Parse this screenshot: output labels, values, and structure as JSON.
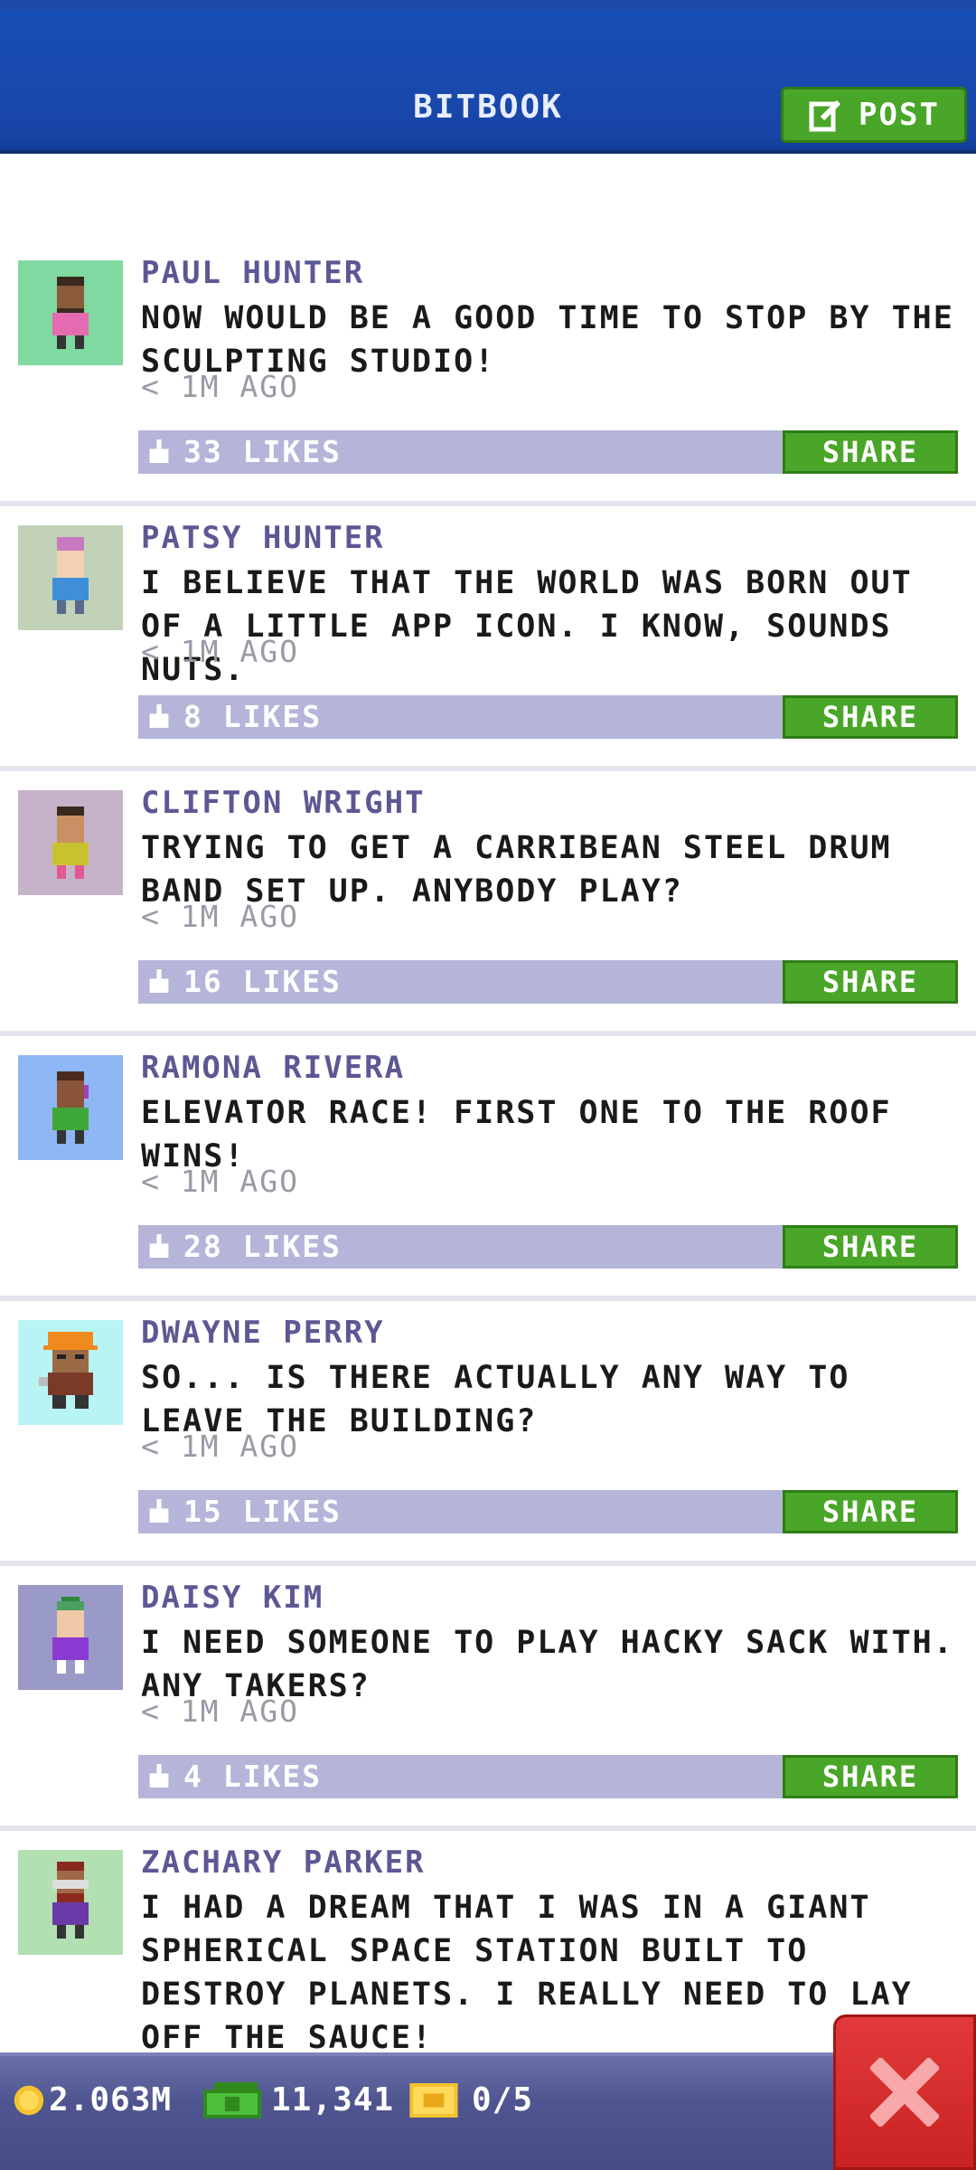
{
  "header": {
    "title": "BITBOOK",
    "post_label": "POST"
  },
  "posts": [
    {
      "author": "PAUL HUNTER",
      "message": "NOW WOULD BE A GOOD TIME TO STOP BY THE SCULPTING STUDIO!",
      "time": "< 1M AGO",
      "likes": "33 LIKES",
      "share": "SHARE",
      "avatar_bg": "#7fd9a0"
    },
    {
      "author": "PATSY HUNTER",
      "message": "I BELIEVE THAT THE WORLD WAS BORN OUT OF A LITTLE APP ICON. I KNOW, SOUNDS NUTS.",
      "time": "< 1M AGO",
      "likes": "8 LIKES",
      "share": "SHARE",
      "avatar_bg": "#c2d2b8"
    },
    {
      "author": "CLIFTON WRIGHT",
      "message": "TRYING TO GET A CARRIBEAN STEEL DRUM BAND SET UP. ANYBODY PLAY?",
      "time": "< 1M AGO",
      "likes": "16 LIKES",
      "share": "SHARE",
      "avatar_bg": "#c6b3c9"
    },
    {
      "author": "RAMONA RIVERA",
      "message": "ELEVATOR RACE! FIRST ONE TO THE ROOF WINS!",
      "time": "< 1M AGO",
      "likes": "28 LIKES",
      "share": "SHARE",
      "avatar_bg": "#8fb6f5"
    },
    {
      "author": "DWAYNE PERRY",
      "message": "SO... IS THERE ACTUALLY ANY WAY TO LEAVE THE BUILDING?",
      "time": "< 1M AGO",
      "likes": "15 LIKES",
      "share": "SHARE",
      "avatar_bg": "#b9f4f4"
    },
    {
      "author": "DAISY KIM",
      "message": "I NEED SOMEONE TO PLAY HACKY SACK WITH. ANY TAKERS?",
      "time": "< 1M AGO",
      "likes": "4 LIKES",
      "share": "SHARE",
      "avatar_bg": "#9a9ac9"
    },
    {
      "author": "ZACHARY PARKER",
      "message": "I HAD A DREAM THAT I WAS IN A GIANT SPHERICAL SPACE STATION BUILT TO DESTROY PLANETS. I REALLY NEED TO LAY OFF THE SAUCE!",
      "time": "",
      "likes": "",
      "share": "",
      "avatar_bg": "#b3e0b3"
    }
  ],
  "footer": {
    "coins": "2.063M",
    "bux": "11,341",
    "tickets": "0/5"
  },
  "colors": {
    "accent_green": "#4aa628",
    "header_blue": "#1745a6",
    "close_red": "#d92b2b"
  },
  "icons": {
    "post": "edit-icon",
    "likes": "thumbs-up-icon",
    "coins": "coin-icon",
    "bux": "bux-icon",
    "tickets": "ticket-icon",
    "close": "close-icon"
  }
}
